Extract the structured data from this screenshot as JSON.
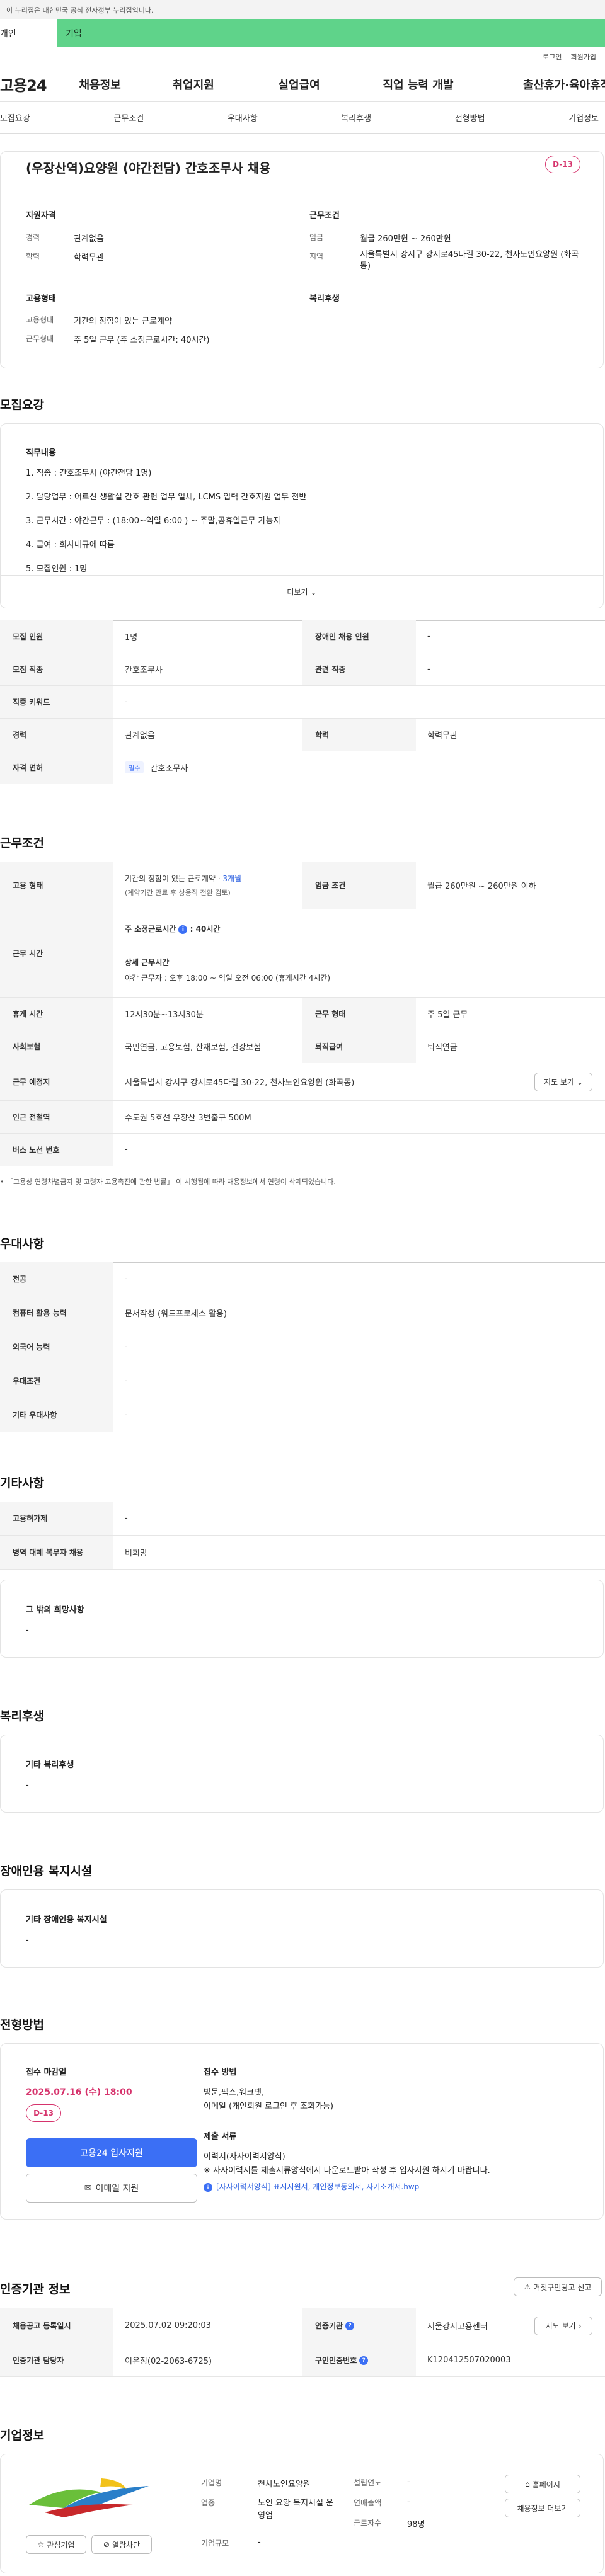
{
  "banner": {
    "text": "이 누리집은 대한민국 공식 전자정부 누리집입니다."
  },
  "tabs": {
    "person": "개인",
    "biz": "기업"
  },
  "utility": {
    "login": "로그인",
    "join": "회원가입"
  },
  "gnb": {
    "logo": "고용24",
    "items": [
      "채용정보",
      "취업지원",
      "실업급여",
      "직업 능력 개발",
      "출산휴가·육아휴직"
    ]
  },
  "subnav": [
    "모집요강",
    "근무조건",
    "우대사항",
    "복리후생",
    "전형방법",
    "기업정보"
  ],
  "job": {
    "title": "(우장산역)요양원 (야간전담) 간호조무사 채용",
    "dday": "D-13",
    "qual_title": "지원자격",
    "qual": [
      {
        "label": "경력",
        "value": "관계없음"
      },
      {
        "label": "학력",
        "value": "학력무관"
      }
    ],
    "cond_title": "근무조건",
    "cond": [
      {
        "label": "임금",
        "value": "월급 260만원 ~ 260만원"
      },
      {
        "label": "지역",
        "value": "서울특별시 강서구 강서로45다길 30-22, 천사노인요양원 (화곡동)"
      }
    ],
    "emp_title": "고용형태",
    "emp": [
      {
        "label": "고용형태",
        "value": "기간의 정함이 있는 근로계약"
      },
      {
        "label": "근무형태",
        "value": "주 5일 근무 (주 소정근로시간: 40시간)"
      }
    ],
    "welfare_title": "복리후생"
  },
  "recruit": {
    "section_title": "모집요강",
    "duty_title": "직무내용",
    "duties": [
      "1. 직종 : 간호조무사 (야간전담 1명)",
      "2. 담당업무 : 어르신 생활실 간호 관련 업무 일체, LCMS 입력 간호지원 업무 전반",
      "3. 근무시간 :  야간근무 : (18:00~익일 6:00 ) ~ 주말,공휴일근무 가능자",
      "4. 급여 : 회사내규에 따름",
      "5. 모집인원 : 1명"
    ],
    "more": "더보기",
    "rows": [
      {
        "th1": "모집 인원",
        "td1": "1명",
        "th2": "장애인 채용 인원",
        "td2": "-"
      },
      {
        "th1": "모집 직종",
        "td1": "간호조무사",
        "th2": "관련 직종",
        "td2": "-"
      },
      {
        "th1": "직종 키워드",
        "td1": "-"
      },
      {
        "th1": "경력",
        "td1": "관계없음",
        "th2": "학력",
        "td2": "학력무관"
      }
    ],
    "license_th": "자격 면허",
    "license_tag": "필수",
    "license_value": "간호조무사"
  },
  "work": {
    "section_title": "근무조건",
    "emp_th": "고용 형태",
    "emp_line1_a": "기간의 정함이 있는 근로계약 · ",
    "emp_line1_b": "3개월",
    "emp_line2": "(계약기간 만료 후 상용직 전환 검토)",
    "wage_th": "임금 조건",
    "wage_td": "월급 260만원 ~ 260만원 이하",
    "hours_th": "근무 시간",
    "hours_main": "주 소정근로시간",
    "hours_main_val": ": 40시간",
    "hours_detail_title": "상세 근무시간",
    "hours_detail": "야간 근무자 : 오후 18:00 ~ 익일 오전 06:00  (휴게시간 4시간)",
    "break_th": "휴게 시간",
    "break_td": "12시30분~13시30분",
    "form_th": "근무 형태",
    "form_td": "주 5일 근무",
    "ins_th": "사회보험",
    "ins_td": "국민연금, 고용보험, 산재보험, 건강보험",
    "ret_th": "퇴직급여",
    "ret_td": "퇴직연금",
    "place_th": "근무 예정지",
    "place_td": "서울특별시 강서구 강서로45다길 30-22, 천사노인요양원 (화곡동)",
    "map_btn": "지도 보기",
    "station_th": "인근 전철역",
    "station_td": "수도권 5호선 우장산 3번출구 500M",
    "bus_th": "버스 노선 번호",
    "bus_td": "-",
    "notice": "「고용상 연령차별금지 및 고령자 고용촉진에 관한 법률」 이 시행됨에 따라 채용정보에서 연령이 삭제되었습니다."
  },
  "pref": {
    "section_title": "우대사항",
    "rows": [
      {
        "th": "전공",
        "td": "-"
      },
      {
        "th": "컴퓨터 활용 능력",
        "td": "문서작성 (워드프로세스 활용)"
      },
      {
        "th": "외국어 능력",
        "td": "-"
      },
      {
        "th": "우대조건",
        "td": "-"
      },
      {
        "th": "기타 우대사항",
        "td": "-"
      }
    ]
  },
  "etc": {
    "section_title": "기타사항",
    "rows": [
      {
        "th": "고용허가제",
        "td": "-"
      },
      {
        "th": "병역 대체 복무자 채용",
        "td": "비희망"
      }
    ],
    "other_title": "그 밖의 희망사항",
    "other_value": "-"
  },
  "welfare": {
    "section_title": "복리후생",
    "box_title": "기타 복리후생",
    "box_value": "-"
  },
  "disabled": {
    "section_title": "장애인용 복지시설",
    "box_title": "기타 장애인용 복지시설",
    "box_value": "-"
  },
  "screening": {
    "section_title": "전형방법",
    "deadline_label": "접수 마감일",
    "deadline": "2025.07.16 (수) 18:00",
    "dday": "D-13",
    "apply_btn": "고용24 입사지원",
    "email_btn": "이메일 지원",
    "method_label": "접수 방법",
    "method_line1": "방문,팩스,워크넷,",
    "method_line2": "이메일 (개인회원 로그인 후 조회가능)",
    "docs_label": "제출 서류",
    "docs_line1": "이력서(자사이력서양식)",
    "docs_line2": "※ 자사이력서를 제출서류양식에서 다운로드받아 작성 후 입사지원 하시기 바랍니다.",
    "docs_link": "[자사이력서양식] 표시지원서, 개인정보동의서, 자기소개서.hwp"
  },
  "agency": {
    "section_title": "인증기관 정보",
    "report_btn": "거짓구인광고 신고",
    "r1_th1": "채용공고 등록일시",
    "r1_td1": "2025.07.02 09:20:03",
    "r1_th2": "인증기관",
    "r1_td2": "서울강서고용센터",
    "map_btn": "지도 보기",
    "r2_th1": "인증기관 담당자",
    "r2_td1": "이은정(02-2063-6725)",
    "r2_th2": "구인인증번호",
    "r2_td2": "K120412507020003"
  },
  "company": {
    "section_title": "기업정보",
    "fav_btn": "관심기업",
    "block_btn": "열람차단",
    "name_label": "기업명",
    "name": "천사노인요양원",
    "industry_label": "업종",
    "industry": "노인 요양 복지시설 운영업",
    "scale_label": "기업규모",
    "scale": "-",
    "found_label": "설립연도",
    "found": "-",
    "sales_label": "연매출액",
    "sales": "-",
    "staff_label": "근로자수",
    "staff": "98명",
    "home_btn": "홈페이지",
    "info_btn": "채용정보 더보기"
  },
  "colors": {
    "accent_green": "#5fd38a",
    "dday_pink": "#d6336c",
    "primary_blue": "#3b6ff5"
  }
}
